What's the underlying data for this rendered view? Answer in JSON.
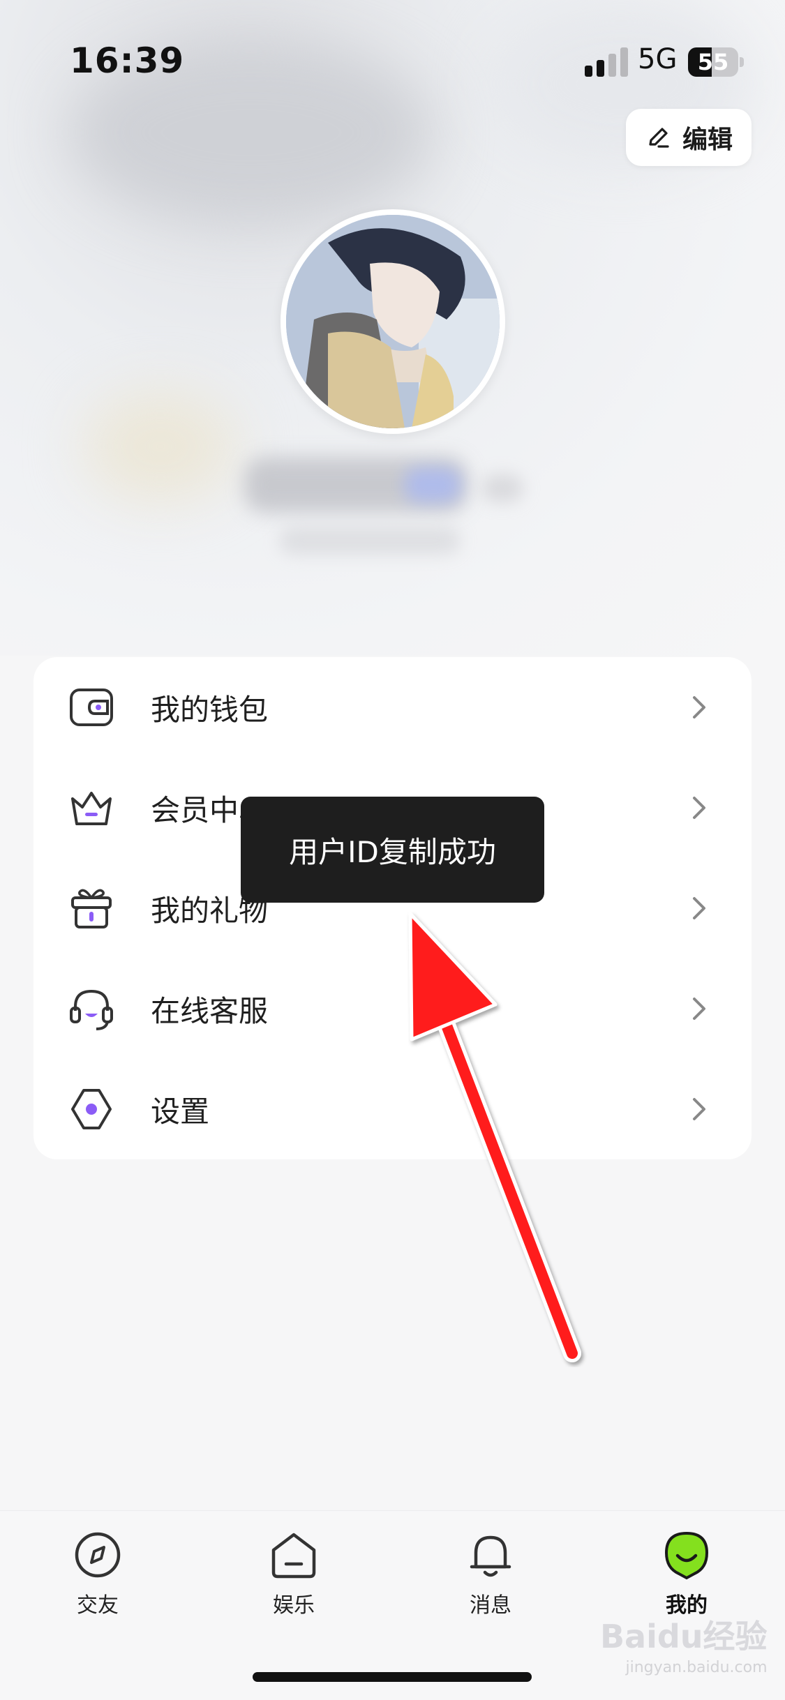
{
  "status_bar": {
    "time": "16:39",
    "network": "5G",
    "battery": "55"
  },
  "header": {
    "edit_label": "编辑"
  },
  "menu": {
    "items": [
      {
        "label": "我的钱包",
        "icon": "wallet-icon"
      },
      {
        "label": "会员中心",
        "icon": "crown-icon"
      },
      {
        "label": "我的礼物",
        "icon": "gift-icon"
      },
      {
        "label": "在线客服",
        "icon": "headset-icon"
      },
      {
        "label": "设置",
        "icon": "settings-icon"
      }
    ]
  },
  "toast": {
    "message": "用户ID复制成功"
  },
  "tab_bar": {
    "tabs": [
      {
        "label": "交友",
        "icon": "compass-icon",
        "active": false
      },
      {
        "label": "娱乐",
        "icon": "home-icon",
        "active": false
      },
      {
        "label": "消息",
        "icon": "bell-icon",
        "active": false
      },
      {
        "label": "我的",
        "icon": "profile-face-icon",
        "active": true
      }
    ]
  },
  "watermark": {
    "text": "Baidu经验",
    "sub": "jingyan.baidu.com"
  },
  "colors": {
    "accent": "#8b5cf6",
    "active_tab": "#84e01e",
    "toast_bg": "#1e1e1e",
    "arrow": "#ff1a1a"
  }
}
